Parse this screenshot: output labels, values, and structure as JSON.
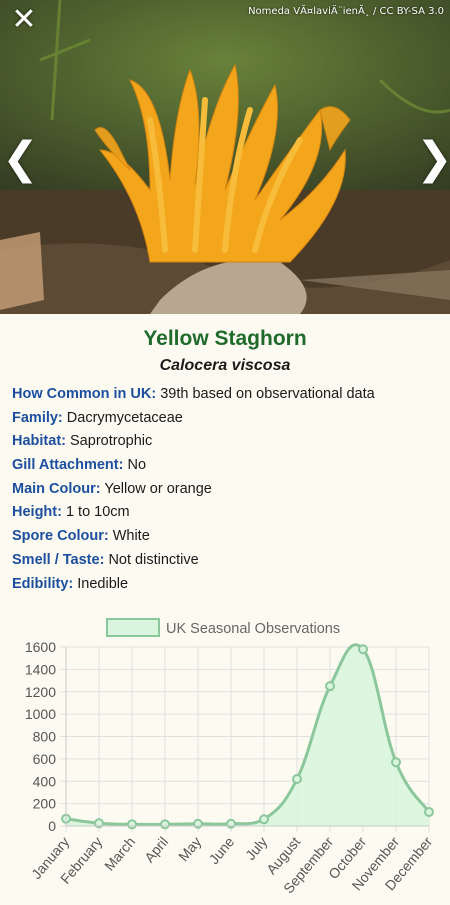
{
  "hero": {
    "credit": "Nomeda VĂ¤laviÄ¨ienĂ˛ / CC BY-SA 3.0",
    "close_icon": "close-icon",
    "prev_icon": "chevron-left-icon",
    "next_icon": "chevron-right-icon",
    "close_glyph": "✕",
    "prev_glyph": "❮",
    "next_glyph": "❯"
  },
  "species": {
    "common_name": "Yellow Staghorn",
    "latin_name": "Calocera viscosa"
  },
  "facts": [
    {
      "label": "How Common in UK:",
      "value": "39th based on observational data"
    },
    {
      "label": "Family:",
      "value": "Dacrymycetaceae"
    },
    {
      "label": "Habitat:",
      "value": "Saprotrophic"
    },
    {
      "label": "Gill Attachment:",
      "value": "No"
    },
    {
      "label": "Main Colour:",
      "value": "Yellow or orange"
    },
    {
      "label": "Height:",
      "value": "1 to 10cm"
    },
    {
      "label": "Spore Colour:",
      "value": "White"
    },
    {
      "label": "Smell / Taste:",
      "value": "Not distinctive"
    },
    {
      "label": "Edibility:",
      "value": "Inedible"
    }
  ],
  "colors": {
    "title_green": "#1f6b2c",
    "label_blue": "#1c4fa0",
    "series_line": "#8cc79c",
    "series_fill": "#d9f5de"
  },
  "chart_data": {
    "type": "area",
    "categories": [
      "January",
      "February",
      "March",
      "April",
      "May",
      "June",
      "July",
      "August",
      "September",
      "October",
      "November",
      "December"
    ],
    "series": [
      {
        "name": "UK Seasonal Observations",
        "values": [
          65,
          25,
          15,
          15,
          20,
          20,
          60,
          420,
          1250,
          1580,
          570,
          125
        ]
      }
    ],
    "yticks": [
      0,
      200,
      400,
      600,
      800,
      1000,
      1200,
      1400,
      1600
    ],
    "ylim": [
      0,
      1600
    ],
    "grid": true,
    "legend": "top-center"
  }
}
